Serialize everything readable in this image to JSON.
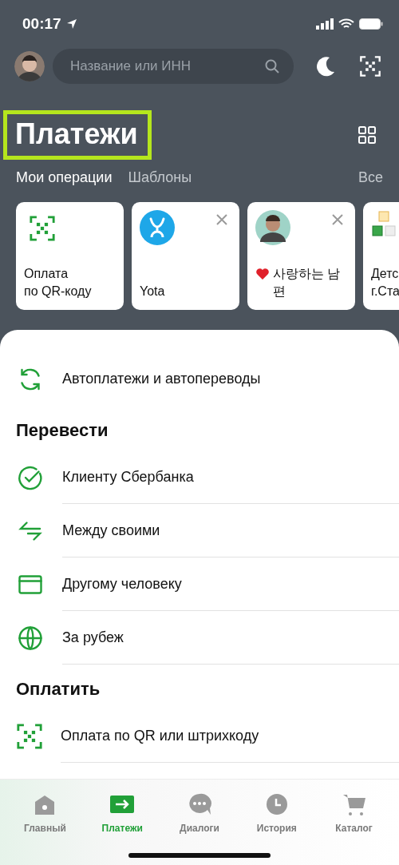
{
  "status_bar": {
    "time": "00:17"
  },
  "search": {
    "placeholder": "Название или ИНН"
  },
  "title": "Платежи",
  "tabs": [
    {
      "label": "Мои операции",
      "selected": true
    },
    {
      "label": "Шаблоны",
      "selected": false
    }
  ],
  "all_link": "Все",
  "cards": [
    {
      "kind": "qr",
      "label": "Оплата\nпо QR-коду",
      "closable": false
    },
    {
      "kind": "logo",
      "label": "Yota",
      "closable": true
    },
    {
      "kind": "avatar",
      "label": "사랑하는 남\n편",
      "heart": true,
      "closable": true
    },
    {
      "kind": "blocks",
      "label": "Детс\nг.Ста",
      "closable": false
    }
  ],
  "sections": [
    {
      "items": [
        {
          "kind": "refresh",
          "label": "Автоплатежи и автопереводы"
        }
      ]
    },
    {
      "title": "Перевести",
      "items": [
        {
          "kind": "check",
          "label": "Клиенту Сбербанка"
        },
        {
          "kind": "arrows",
          "label": "Между своими"
        },
        {
          "kind": "card",
          "label": "Другому человеку"
        },
        {
          "kind": "globe",
          "label": "За рубеж"
        }
      ]
    },
    {
      "title": "Оплатить",
      "items": [
        {
          "kind": "qr",
          "label": "Оплата по QR или штрихкоду"
        }
      ]
    }
  ],
  "nav": [
    {
      "kind": "home",
      "label": "Главный",
      "selected": false
    },
    {
      "kind": "payments",
      "label": "Платежи",
      "selected": true
    },
    {
      "kind": "chat",
      "label": "Диалоги",
      "selected": false
    },
    {
      "kind": "clock",
      "label": "История",
      "selected": false
    },
    {
      "kind": "cart",
      "label": "Каталог",
      "selected": false
    }
  ]
}
